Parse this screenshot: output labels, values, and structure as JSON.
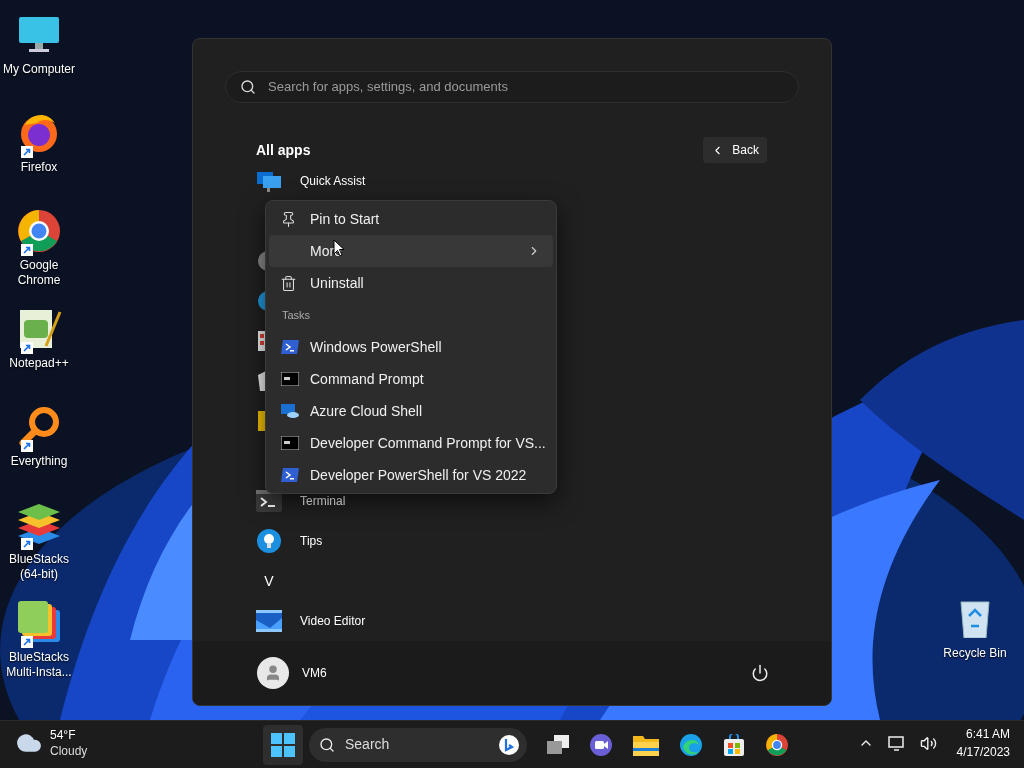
{
  "desktop_icons": [
    {
      "label": "My Computer",
      "shortcut": false
    },
    {
      "label": "Firefox",
      "shortcut": true
    },
    {
      "label": "Google Chrome",
      "shortcut": true
    },
    {
      "label": "Notepad++",
      "shortcut": true
    },
    {
      "label": "Everything",
      "shortcut": true
    },
    {
      "label": "BlueStacks (64-bit)",
      "shortcut": true
    },
    {
      "label": "BlueStacks Multi-Insta...",
      "shortcut": true
    }
  ],
  "recycle_bin": {
    "label": "Recycle Bin"
  },
  "start_menu": {
    "search": {
      "placeholder": "Search for apps, settings, and documents"
    },
    "heading": "All apps",
    "back_button": "Back",
    "apps": [
      {
        "kind": "app",
        "name": "Quick Assist"
      },
      {
        "kind": "covered"
      },
      {
        "kind": "covered"
      },
      {
        "kind": "covered"
      },
      {
        "kind": "covered"
      },
      {
        "kind": "covered"
      },
      {
        "kind": "covered"
      },
      {
        "kind": "covered"
      },
      {
        "kind": "app",
        "name": "Terminal"
      },
      {
        "kind": "app",
        "name": "Tips"
      },
      {
        "kind": "letter",
        "name": "V"
      },
      {
        "kind": "app",
        "name": "Video Editor"
      }
    ],
    "user": {
      "name": "VM6"
    }
  },
  "context_menu": {
    "actions": [
      {
        "label": "Pin to Start",
        "selected": false,
        "submenu": false
      },
      {
        "label": "More",
        "selected": true,
        "submenu": true
      },
      {
        "label": "Uninstall",
        "selected": false,
        "submenu": false
      }
    ],
    "section_label": "Tasks",
    "tasks": [
      {
        "label": "Windows PowerShell"
      },
      {
        "label": "Command Prompt"
      },
      {
        "label": "Azure Cloud Shell"
      },
      {
        "label": "Developer Command Prompt for VS..."
      },
      {
        "label": "Developer PowerShell for VS 2022"
      }
    ]
  },
  "taskbar": {
    "weather": {
      "temperature": "54°F",
      "condition": "Cloudy"
    },
    "search_label": "Search",
    "clock": {
      "time": "6:41 AM",
      "date": "4/17/2023"
    }
  }
}
